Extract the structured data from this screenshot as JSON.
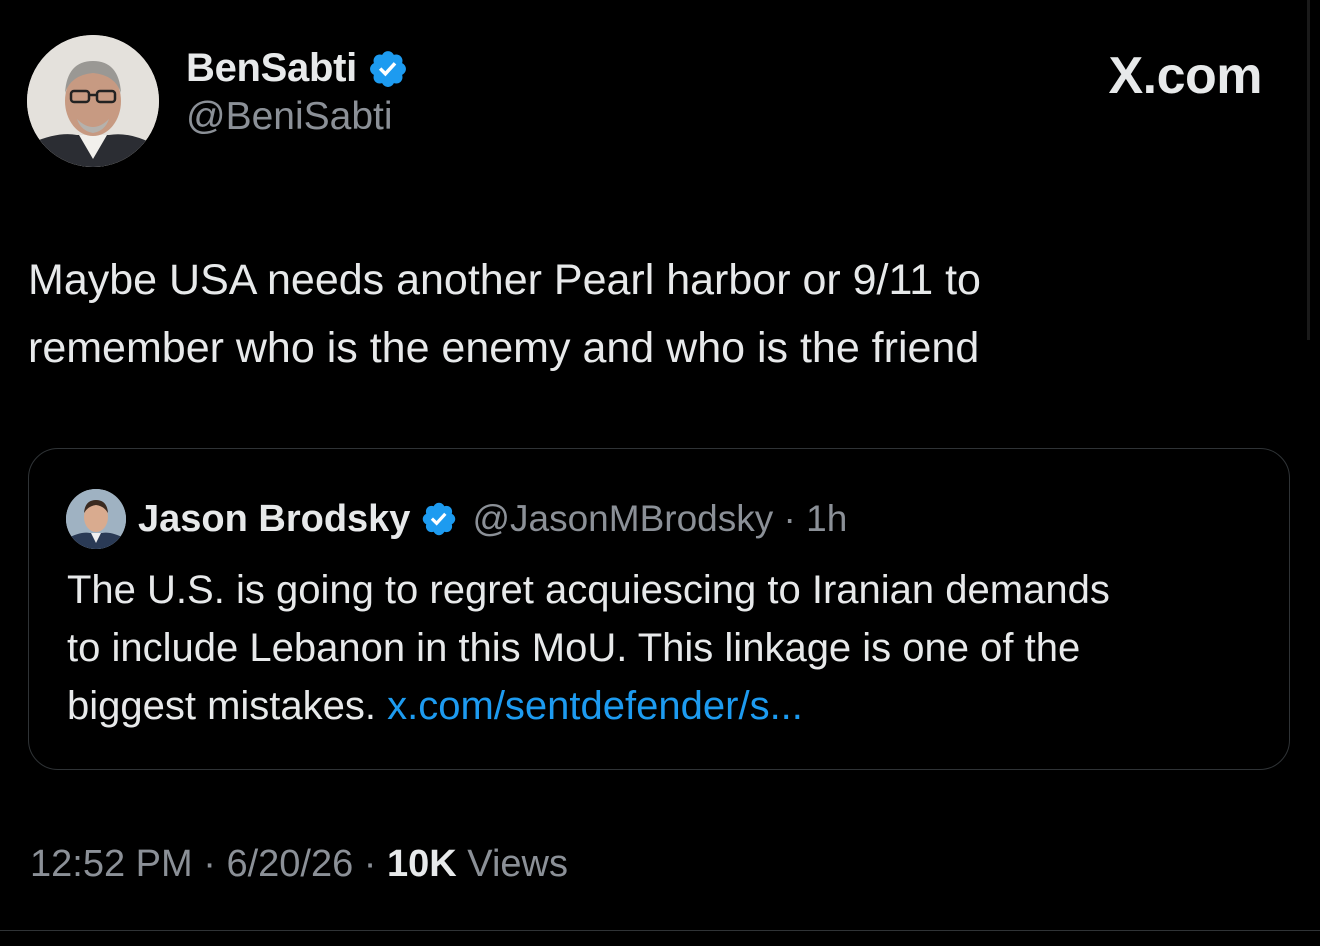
{
  "author": {
    "display_name": "BenSabti",
    "handle": "@BeniSabti",
    "verified_icon": "verified-badge-icon"
  },
  "site_label": "X.com",
  "tweet": {
    "text_line1": "Maybe USA needs another Pearl harbor or 9/11 to",
    "text_line2": "remember who is the enemy and who is the friend"
  },
  "quoted_tweet": {
    "display_name": "Jason Brodsky",
    "handle": "@JasonMBrodsky",
    "separator": " · ",
    "time_ago": "1h",
    "text_line1": "The U.S. is going to regret acquiescing to Iranian demands",
    "text_line2": "to include Lebanon in this MoU. This linkage is one of the",
    "text_line3": "biggest mistakes. ",
    "link": "x.com/sentdefender/s..."
  },
  "footer": {
    "time": "12:52 PM",
    "sep1": " · ",
    "date": "6/20/26",
    "sep2": " · ",
    "views_count": "10K",
    "views_label": " Views"
  },
  "colors": {
    "background": "#000000",
    "text_primary": "#e7e9ea",
    "text_secondary": "#8b9097",
    "link": "#1d9bf0",
    "verified": "#1d9bf0",
    "border": "#2f3336"
  }
}
